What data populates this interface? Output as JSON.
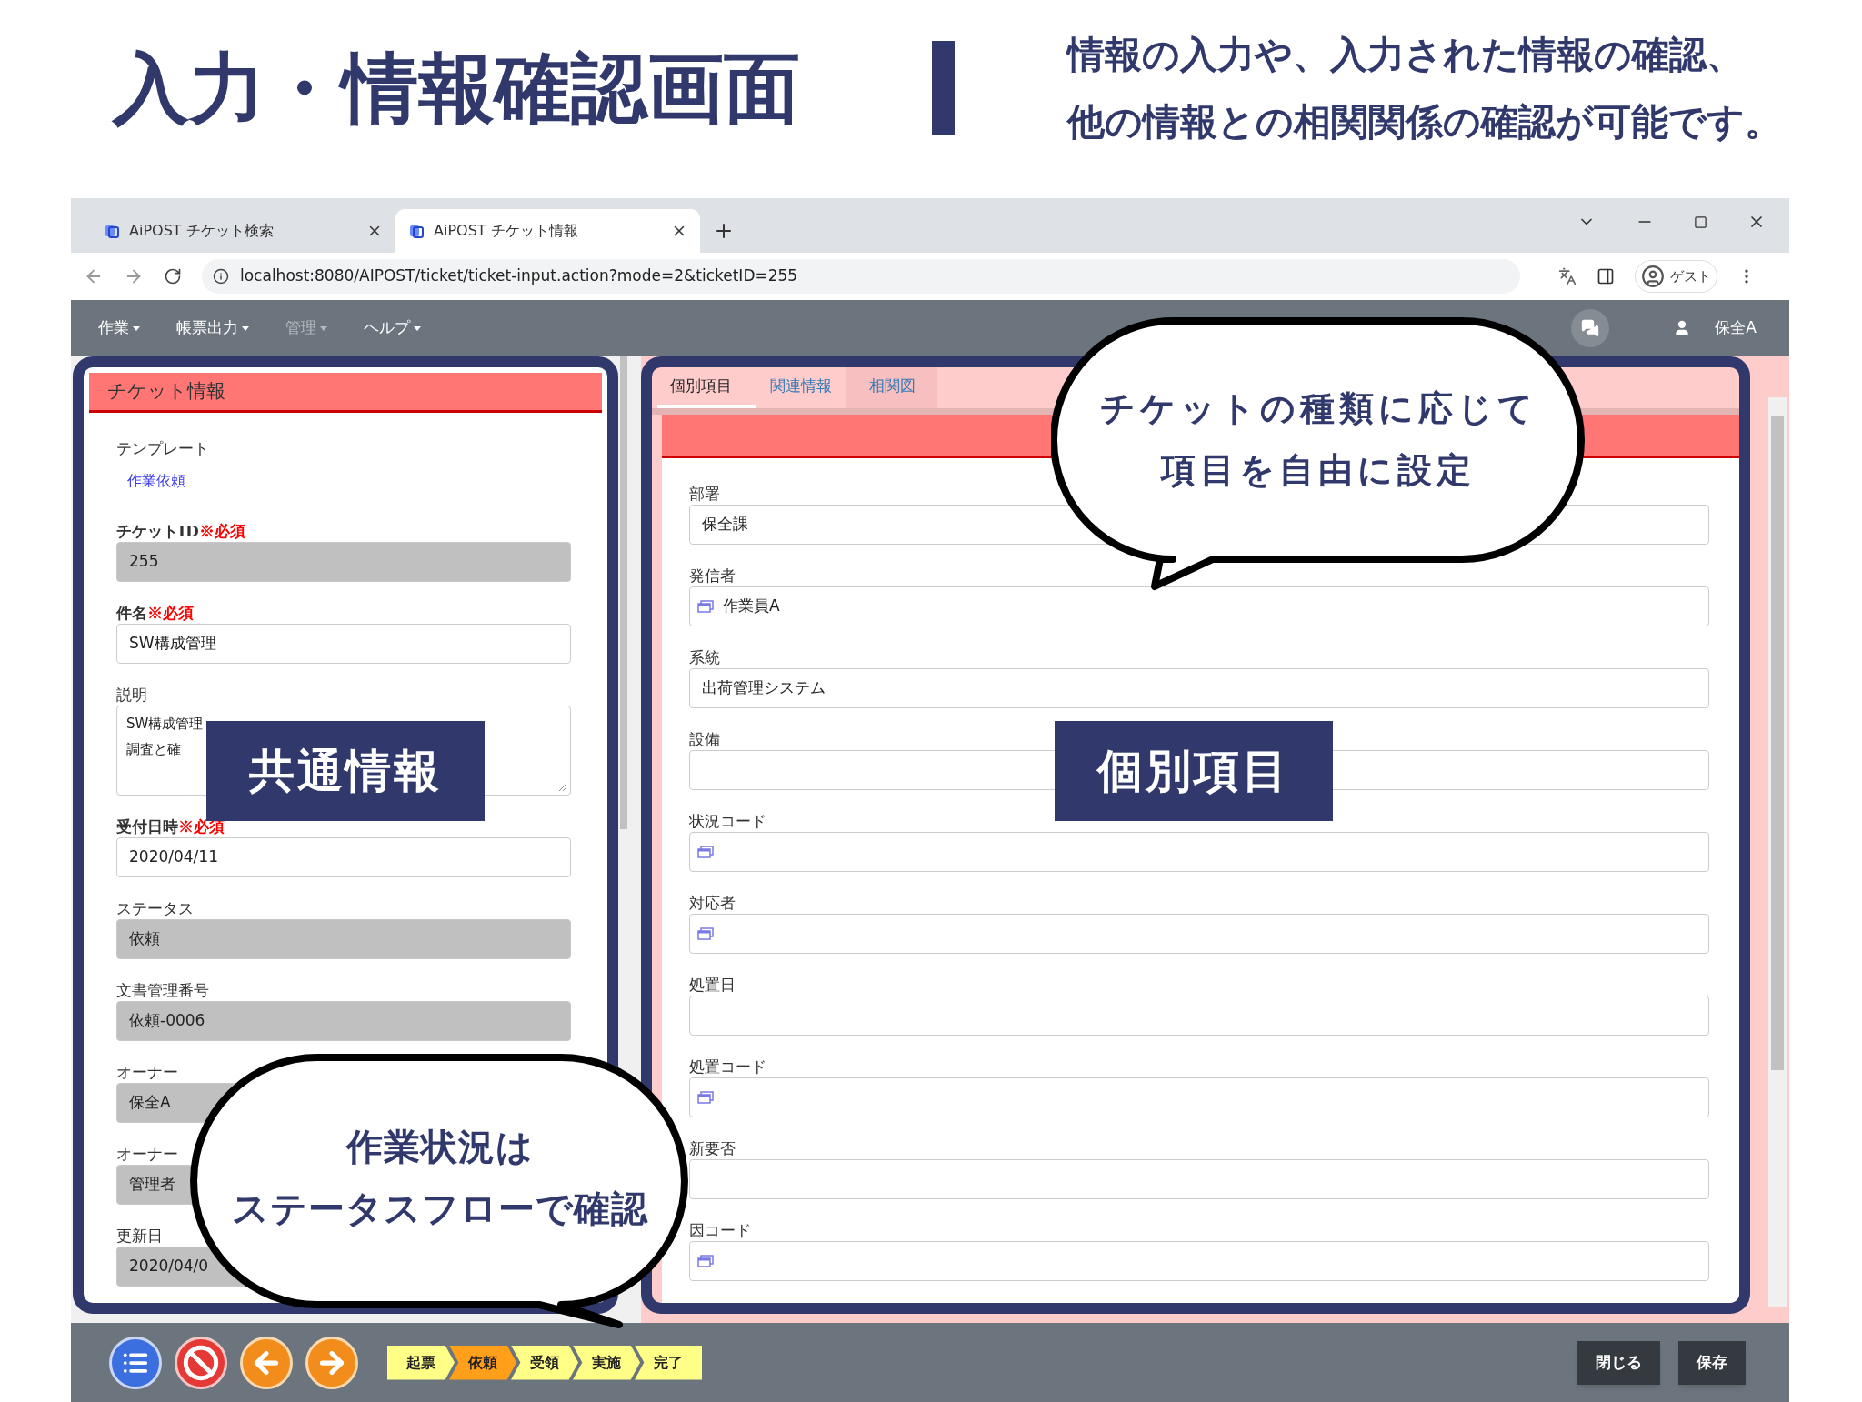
{
  "slide": {
    "title": "入力・情報確認画面",
    "description": [
      "情報の入力や、入力された情報の確認、",
      "他の情報との相関関係の確認が可能です。"
    ]
  },
  "browser": {
    "tabs": [
      {
        "title": "AiPOST チケット検索",
        "selected": false
      },
      {
        "title": "AiPOST チケット情報",
        "selected": true
      }
    ],
    "address": "localhost:8080/AIPOST/ticket/ticket-input.action?mode=2&ticketID=255",
    "profile": "ゲスト"
  },
  "app": {
    "menu": [
      {
        "label": "作業",
        "disabled": false
      },
      {
        "label": "帳票出力",
        "disabled": false
      },
      {
        "label": "管理",
        "disabled": true
      },
      {
        "label": "ヘルプ",
        "disabled": false
      }
    ],
    "user": "保全A"
  },
  "ticket_panel": {
    "title": "チケット情報",
    "fields": [
      {
        "label": "テンプレート",
        "kind": "link",
        "value": "作業依頼"
      },
      {
        "label": "チケットID",
        "required": "※必須",
        "kind": "readonly",
        "value": "255"
      },
      {
        "label": "件名",
        "required": "※必須",
        "kind": "text",
        "value": "SW構成管理"
      },
      {
        "label": "説明",
        "kind": "textarea",
        "lines": [
          "SW構成管理",
          "調査と確"
        ]
      },
      {
        "label": "受付日時",
        "required": "※必須",
        "kind": "text",
        "value": "2020/04/11"
      },
      {
        "label": "ステータス",
        "kind": "readonly",
        "value": "依頼"
      },
      {
        "label": "文書管理番号",
        "kind": "readonly",
        "value": "依頼-0006"
      },
      {
        "label": "オーナー",
        "kind": "readonly",
        "value": "保全A"
      },
      {
        "label": "オーナー",
        "kind": "readonly",
        "value": "管理者"
      },
      {
        "label": "更新日",
        "kind": "readonly",
        "value": "2020/04/0"
      }
    ]
  },
  "detail_panel": {
    "tabs": [
      {
        "label": "個別項目",
        "selected": true
      },
      {
        "label": "関連情報",
        "selected": false
      },
      {
        "label": "相関図",
        "selected": false
      }
    ],
    "fields": [
      {
        "label": "部署",
        "kind": "text",
        "value": "保全課"
      },
      {
        "label": "発信者",
        "kind": "picker",
        "value": "作業員A"
      },
      {
        "label": "系統",
        "kind": "text",
        "value": "出荷管理システム"
      },
      {
        "label": "設備",
        "kind": "text"
      },
      {
        "label": "状況コード",
        "kind": "picker"
      },
      {
        "label": "対応者",
        "kind": "picker"
      },
      {
        "label": "処置日",
        "kind": "text"
      },
      {
        "label": "処置コード",
        "kind": "picker"
      },
      {
        "label": "新要否",
        "kind": "text"
      },
      {
        "label": "因コード",
        "kind": "picker"
      }
    ]
  },
  "footer": {
    "status_flow": [
      {
        "label": "起票",
        "selected": false
      },
      {
        "label": "依頼",
        "selected": true
      },
      {
        "label": "受領",
        "selected": false
      },
      {
        "label": "実施",
        "selected": false
      },
      {
        "label": "完了",
        "selected": false
      }
    ],
    "buttons": [
      "閉じる",
      "保存"
    ]
  },
  "callouts": [
    {
      "kind": "bubble",
      "lines": [
        "チケットの種類に応じて",
        "項目を自由に設定"
      ]
    },
    {
      "kind": "label",
      "lines": [
        "共通情報"
      ]
    },
    {
      "kind": "label",
      "lines": [
        "個別項目"
      ]
    },
    {
      "kind": "bubble",
      "lines": [
        "作業状況は",
        "ステータスフローで確認"
      ]
    }
  ]
}
